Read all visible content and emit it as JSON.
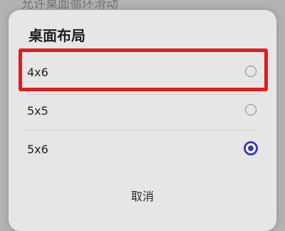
{
  "background": {
    "partial_title": "允许桌面循环滑动"
  },
  "dialog": {
    "title": "桌面布局",
    "options": [
      {
        "label": "4x6",
        "selected": false,
        "highlighted": true
      },
      {
        "label": "5x5",
        "selected": false,
        "highlighted": false
      },
      {
        "label": "5x6",
        "selected": true,
        "highlighted": false
      }
    ],
    "cancel_label": "取消"
  },
  "colors": {
    "accent": "#3a3fb4",
    "highlight": "#e11d1d",
    "dialog_bg": "#e6e6e6"
  }
}
